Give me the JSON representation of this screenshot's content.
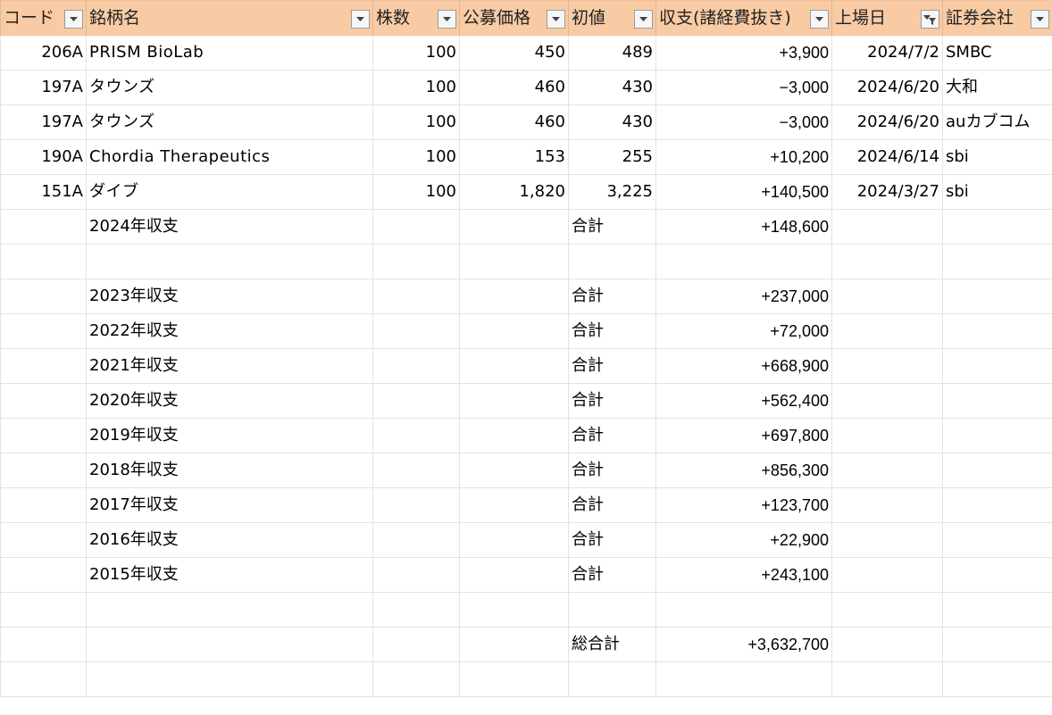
{
  "headers": [
    {
      "key": "code",
      "label": "コード"
    },
    {
      "key": "name",
      "label": "銘柄名"
    },
    {
      "key": "shares",
      "label": "株数"
    },
    {
      "key": "offer",
      "label": "公募価格"
    },
    {
      "key": "first",
      "label": "初値"
    },
    {
      "key": "pnl",
      "label": "収支(諸経費抜き)"
    },
    {
      "key": "listed",
      "label": "上場日"
    },
    {
      "key": "broker",
      "label": "証券会社"
    }
  ],
  "rows": [
    {
      "code": "206A",
      "name": "PRISM  BioLab",
      "shares": "100",
      "offer": "450",
      "first": "489",
      "pnl": "+3,900",
      "listed": "2024/7/2",
      "broker": "SMBC"
    },
    {
      "code": "197A",
      "name": "タウンズ",
      "shares": "100",
      "offer": "460",
      "first": "430",
      "pnl": "−3,000",
      "listed": "2024/6/20",
      "broker": "大和"
    },
    {
      "code": "197A",
      "name": "タウンズ",
      "shares": "100",
      "offer": "460",
      "first": "430",
      "pnl": "−3,000",
      "listed": "2024/6/20",
      "broker": "auカブコム"
    },
    {
      "code": "190A",
      "name": "Chordia  Therapeutics",
      "shares": "100",
      "offer": "153",
      "first": "255",
      "pnl": "+10,200",
      "listed": "2024/6/14",
      "broker": "sbi"
    },
    {
      "code": "151A",
      "name": "ダイブ",
      "shares": "100",
      "offer": "1,820",
      "first": "3,225",
      "pnl": "+140,500",
      "listed": "2024/3/27",
      "broker": "sbi"
    }
  ],
  "summary_2024": {
    "label": "2024年収支",
    "total_label": "合計",
    "value": "+148,600"
  },
  "yearly": [
    {
      "label": "2023年収支",
      "total_label": "合計",
      "value": "+237,000"
    },
    {
      "label": "2022年収支",
      "total_label": "合計",
      "value": "+72,000"
    },
    {
      "label": "2021年収支",
      "total_label": "合計",
      "value": "+668,900"
    },
    {
      "label": "2020年収支",
      "total_label": "合計",
      "value": "+562,400"
    },
    {
      "label": "2019年収支",
      "total_label": "合計",
      "value": "+697,800"
    },
    {
      "label": "2018年収支",
      "total_label": "合計",
      "value": "+856,300"
    },
    {
      "label": "2017年収支",
      "total_label": "合計",
      "value": "+123,700"
    },
    {
      "label": "2016年収支",
      "total_label": "合計",
      "value": "+22,900"
    },
    {
      "label": "2015年収支",
      "total_label": "合計",
      "value": "+243,100"
    }
  ],
  "grand_total": {
    "label": "総合計",
    "value": "+3,632,700"
  },
  "filter_active_column": "listed",
  "colors": {
    "header_bg": "#f8cba4",
    "gridline": "#e3e3e3"
  },
  "icons": {
    "filter": "dropdown-arrow-icon",
    "filter_active": "filter-funnel-icon"
  }
}
